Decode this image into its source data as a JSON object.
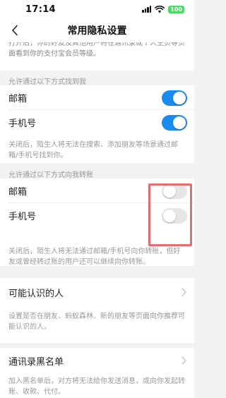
{
  "status_bar": {
    "time": "17:14",
    "battery": "100"
  },
  "nav": {
    "title": "常用隐私设置"
  },
  "top_desc": "打开后，你的好友及其他用户将在通讯录或个人主页等页面看到你的支付宝会员等级。",
  "section_find": {
    "header": "允许通过以下方式找到我",
    "items": [
      {
        "label": "邮箱",
        "enabled": true
      },
      {
        "label": "手机号",
        "enabled": true
      }
    ],
    "note": "关闭后，陌生人将无法在搜索、添加朋友等场景通过邮箱/手机号找到你。"
  },
  "section_transfer": {
    "header": "允许通过以下方式向我转账",
    "items": [
      {
        "label": "邮箱",
        "enabled": false
      },
      {
        "label": "手机号",
        "enabled": false
      }
    ],
    "note": "关闭后，陌生人将无法通过邮箱/手机号向你转账，但好友或曾经转过账的用户还可以继续向你转账。"
  },
  "people_you_may_know": {
    "label": "可能认识的人",
    "note": "设置是否在朋友、蚂蚁森林、新的朋友等页面向你推荐可能认识的人。"
  },
  "contact_blacklist": {
    "label": "通讯录黑名单",
    "note": "加入黑名单后，对方将无法给你发送消息，或向你发起转账、收款、代付。"
  },
  "colors": {
    "toggle_on": "#1a8cf0",
    "toggle_off": "#e6e6e6",
    "highlight": "#e86b72",
    "background": "#f2f2f2"
  },
  "icons": {
    "back": "chevron-left-icon",
    "row_arrow": "chevron-right-icon",
    "status": [
      "signal-icon",
      "wifi-icon",
      "battery-icon"
    ]
  }
}
